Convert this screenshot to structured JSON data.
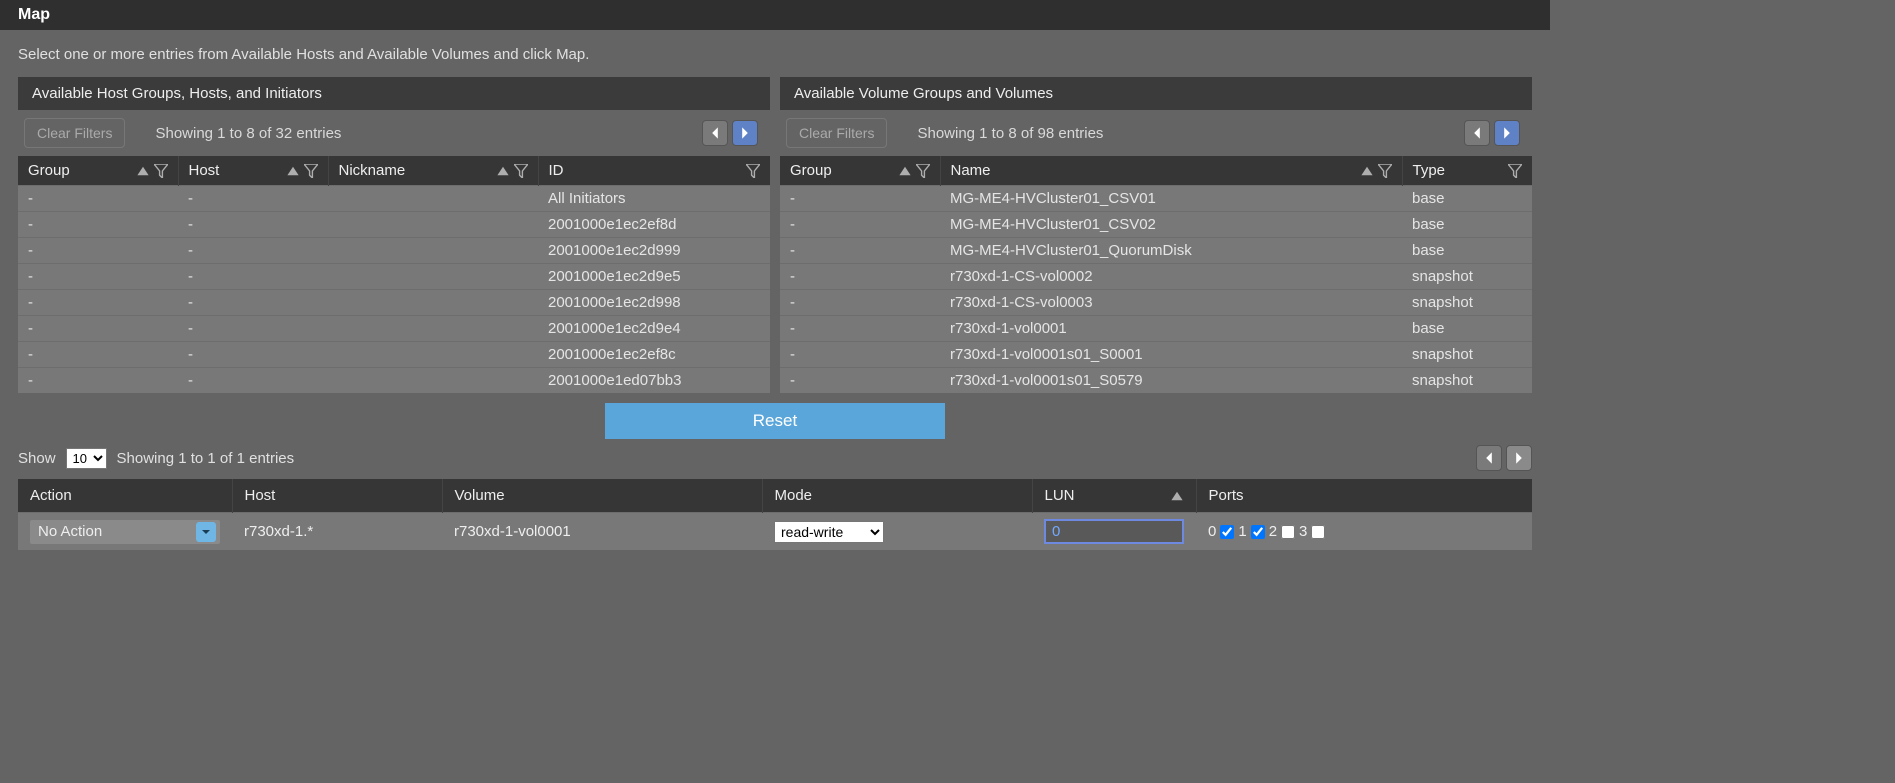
{
  "title": "Map",
  "instruction": "Select one or more entries from Available Hosts and Available Volumes and click Map.",
  "hosts_panel": {
    "header": "Available Host Groups, Hosts, and Initiators",
    "clear": "Clear Filters",
    "showing": "Showing 1 to 8 of 32 entries",
    "columns": {
      "group": "Group",
      "host": "Host",
      "nickname": "Nickname",
      "id": "ID"
    },
    "rows": [
      {
        "group": "-",
        "host": "-",
        "nickname": "",
        "id": "All Initiators"
      },
      {
        "group": "-",
        "host": "-",
        "nickname": "",
        "id": "2001000e1ec2ef8d"
      },
      {
        "group": "-",
        "host": "-",
        "nickname": "",
        "id": "2001000e1ec2d999"
      },
      {
        "group": "-",
        "host": "-",
        "nickname": "",
        "id": "2001000e1ec2d9e5"
      },
      {
        "group": "-",
        "host": "-",
        "nickname": "",
        "id": "2001000e1ec2d998"
      },
      {
        "group": "-",
        "host": "-",
        "nickname": "",
        "id": "2001000e1ec2d9e4"
      },
      {
        "group": "-",
        "host": "-",
        "nickname": "",
        "id": "2001000e1ec2ef8c"
      },
      {
        "group": "-",
        "host": "-",
        "nickname": "",
        "id": "2001000e1ed07bb3"
      }
    ]
  },
  "volumes_panel": {
    "header": "Available Volume Groups and Volumes",
    "clear": "Clear Filters",
    "showing": "Showing 1 to 8 of 98 entries",
    "columns": {
      "group": "Group",
      "name": "Name",
      "type": "Type"
    },
    "rows": [
      {
        "group": "-",
        "name": "MG-ME4-HVCluster01_CSV01",
        "type": "base"
      },
      {
        "group": "-",
        "name": "MG-ME4-HVCluster01_CSV02",
        "type": "base"
      },
      {
        "group": "-",
        "name": "MG-ME4-HVCluster01_QuorumDisk",
        "type": "base"
      },
      {
        "group": "-",
        "name": "r730xd-1-CS-vol0002",
        "type": "snapshot"
      },
      {
        "group": "-",
        "name": "r730xd-1-CS-vol0003",
        "type": "snapshot"
      },
      {
        "group": "-",
        "name": "r730xd-1-vol0001",
        "type": "base"
      },
      {
        "group": "-",
        "name": "r730xd-1-vol0001s01_S0001",
        "type": "snapshot"
      },
      {
        "group": "-",
        "name": "r730xd-1-vol0001s01_S0579",
        "type": "snapshot"
      }
    ]
  },
  "reset_label": "Reset",
  "lower": {
    "show_label": "Show",
    "show_value": "10",
    "showing": "Showing 1 to 1 of 1 entries",
    "columns": {
      "action": "Action",
      "host": "Host",
      "volume": "Volume",
      "mode": "Mode",
      "lun": "LUN",
      "ports": "Ports"
    },
    "row": {
      "action": "No Action",
      "host": "r730xd-1.*",
      "volume": "r730xd-1-vol0001",
      "mode": "read-write",
      "lun": "0",
      "ports": [
        {
          "label": "0",
          "checked": true
        },
        {
          "label": "1",
          "checked": true
        },
        {
          "label": "2",
          "checked": false
        },
        {
          "label": "3",
          "checked": false
        }
      ]
    }
  }
}
